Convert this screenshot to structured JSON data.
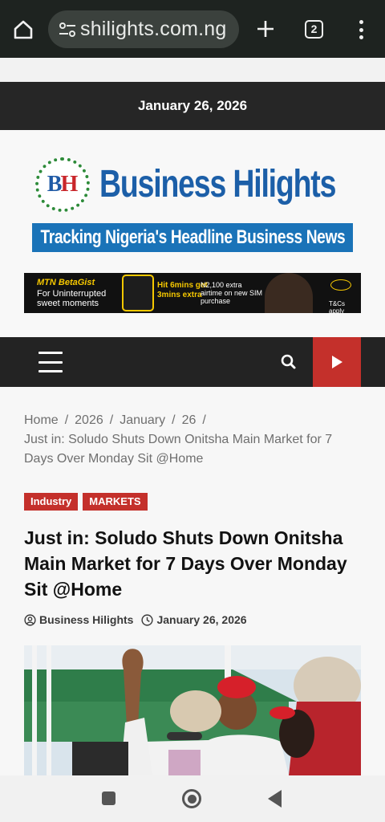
{
  "browser": {
    "url": "shilights.com.ng",
    "tab_count": "2"
  },
  "site": {
    "date": "January 26, 2026",
    "logo_letters": {
      "b": "B",
      "h": "H"
    },
    "logo_name": "Business Hilights",
    "tagline": "Tracking Nigeria's Headline Business News"
  },
  "ad": {
    "brand": "MTN BetaGist",
    "sub": "For Uninterrupted sweet moments",
    "offer": "Hit 6mins get 3mins extra",
    "airtime": "N2,100 extra airtime on new SIM purchase",
    "tc": "T&Cs apply"
  },
  "breadcrumb": {
    "items": [
      "Home",
      "2026",
      "January",
      "26"
    ],
    "separator": "/",
    "current": "Just in: Soludo Shuts Down Onitsha Main Market for 7 Days Over Monday Sit @Home"
  },
  "article": {
    "tags": [
      "Industry",
      "MARKETS"
    ],
    "title": "Just in: Soludo Shuts Down Onitsha Main Market for 7 Days Over Monday Sit @Home",
    "author": "Business Hilights",
    "date": "January 26, 2026"
  },
  "colors": {
    "accent_red": "#c4302b",
    "brand_blue": "#1c5fa8",
    "nav_dark": "#232323"
  }
}
